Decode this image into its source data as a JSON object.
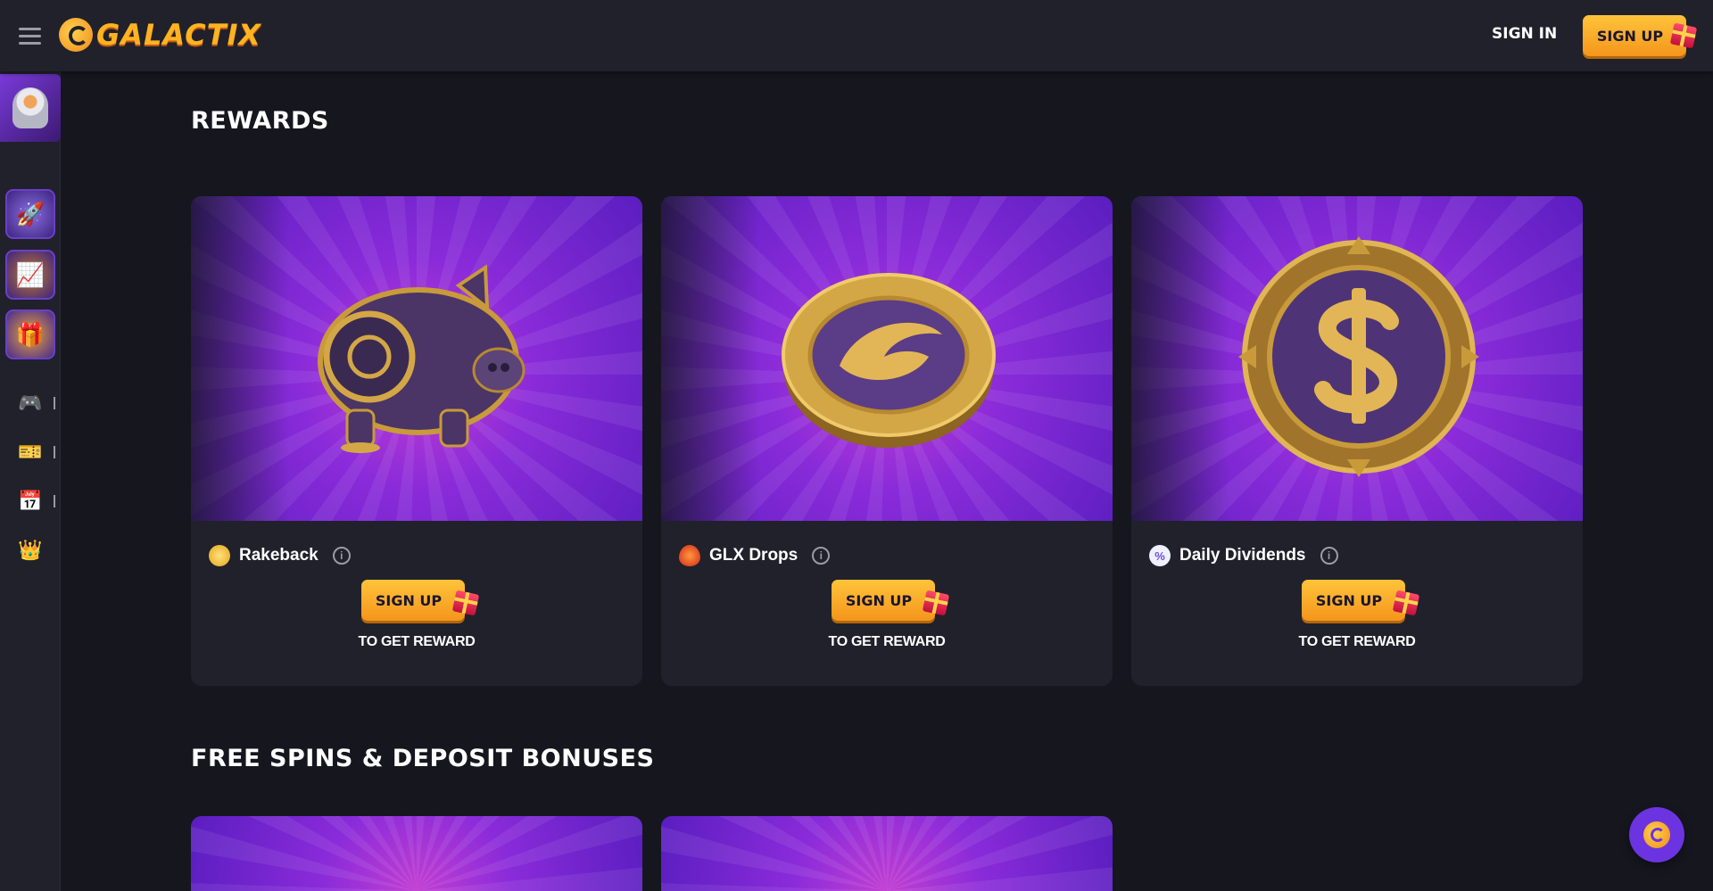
{
  "header": {
    "logo_text": "GALACTIX",
    "signin_label": "SIGN IN",
    "signup_label": "SIGN UP"
  },
  "sidebar": {
    "items": [
      {
        "icon": "astronaut-avatar"
      },
      {
        "icon": "rocket-game-tile"
      },
      {
        "icon": "chart-game-tile"
      },
      {
        "icon": "gift-box-game-tile"
      },
      {
        "icon": "gamepad-icon"
      },
      {
        "icon": "ticket-icon"
      },
      {
        "icon": "calendar-icon"
      },
      {
        "icon": "crown-icon"
      }
    ]
  },
  "main": {
    "rewards_title": "REWARDS",
    "bonuses_title": "FREE SPINS & DEPOSIT BONUSES",
    "cards": [
      {
        "name": "Rakeback",
        "button": "SIGN UP",
        "sub": "TO GET REWARD",
        "icon": "rakeback-coins-icon"
      },
      {
        "name": "GLX Drops",
        "button": "SIGN UP",
        "sub": "TO GET REWARD",
        "icon": "glx-drop-icon"
      },
      {
        "name": "Daily Dividends",
        "button": "SIGN UP",
        "sub": "TO GET REWARD",
        "icon": "percent-badge-icon"
      }
    ]
  },
  "colors": {
    "background": "#16161f",
    "panel": "#20212b",
    "accent": "#ffb321",
    "purple": "#6b34e0"
  }
}
